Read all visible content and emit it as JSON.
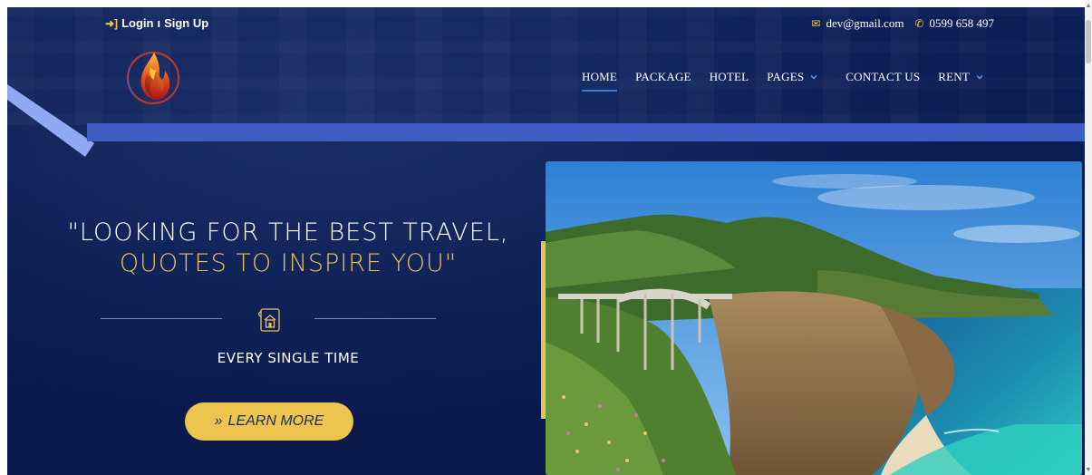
{
  "topbar": {
    "login_label": "Login",
    "separator": "ı",
    "signup_label": "Sign Up",
    "email": "dev@gmail.com",
    "phone": "0599 658 497",
    "login_icon": "sign-in-icon",
    "email_icon": "envelope-icon",
    "phone_icon": "phone-icon"
  },
  "nav": {
    "items": [
      {
        "label": "HOME",
        "active": true
      },
      {
        "label": "PACKAGE"
      },
      {
        "label": "HOTEL"
      },
      {
        "label": "PAGES",
        "dropdown": true
      },
      {
        "label": "CONTACT US"
      },
      {
        "label": "RENT",
        "dropdown": true
      }
    ]
  },
  "hero": {
    "headline_line1": "\"LOOKING FOR THE BEST TRAVEL,",
    "headline_line2": "QUOTES TO INSPIRE YOU\"",
    "tagline": "EVERY SINGLE TIME",
    "cta_icon": "»",
    "cta_label": "LEARN MORE",
    "photo": "coastal-bridge-photo"
  },
  "colors": {
    "background": "#0a1d52",
    "accent_gold": "#e8c15a",
    "band_blue": "#3d5fc4",
    "stripe_blue": "#8fa9f2",
    "button_yellow": "#ecc44e"
  }
}
